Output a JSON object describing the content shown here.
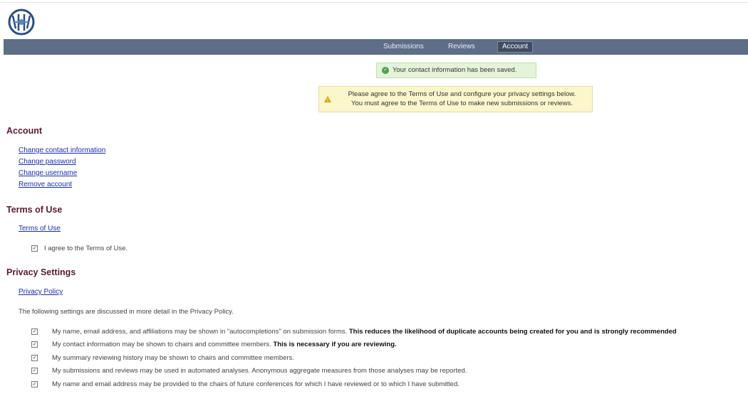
{
  "nav": {
    "items": [
      {
        "label": "Submissions",
        "active": false
      },
      {
        "label": "Reviews",
        "active": false
      },
      {
        "label": "Account",
        "active": true
      }
    ]
  },
  "alerts": {
    "success": "Your contact information has been saved.",
    "warning_line1": "Please agree to the Terms of Use and configure your privacy settings below.",
    "warning_line2": "You must agree to the Terms of Use to make new submissions or reviews."
  },
  "account": {
    "heading": "Account",
    "links": [
      "Change contact information",
      "Change password",
      "Change username",
      "Remove account"
    ]
  },
  "terms": {
    "heading": "Terms of Use",
    "link": "Terms of Use",
    "agree_label": "I agree to the Terms of Use.",
    "agree_checked": true
  },
  "privacy": {
    "heading": "Privacy Settings",
    "link": "Privacy Policy",
    "intro": "The following settings are discussed in more detail in the Privacy Policy.",
    "settings": [
      {
        "text": "My name, email address, and affiliations may be shown in \"autocompletions\" on submission forms.",
        "bold": "This reduces the likelihood of duplicate accounts being created for you and is strongly recommended",
        "checked": true
      },
      {
        "text": "My contact information may be shown to chairs and committee members.",
        "bold": "This is necessary if you are reviewing.",
        "checked": true
      },
      {
        "text": "My summary reviewing history may be shown to chairs and committee members.",
        "bold": "",
        "checked": true
      },
      {
        "text": "My submissions and reviews may be used in automated analyses. Anonymous aggregate measures from those analyses may be reported.",
        "bold": "",
        "checked": true
      },
      {
        "text": "My name and email address may be provided to the chairs of future conferences for which I have reviewed or to which I have submitted.",
        "bold": "",
        "checked": true
      }
    ]
  },
  "colors": {
    "nav_bg": "#5d6e86",
    "heading": "#5b1a32",
    "link": "#1a2fb0",
    "success_bg": "#e4f4d9",
    "warning_bg": "#fbf6cc"
  },
  "icons": {
    "logo": "conference-logo",
    "success": "check-circle-icon",
    "warning": "warning-triangle-icon",
    "checkbox": "checkbox-checked-icon"
  }
}
